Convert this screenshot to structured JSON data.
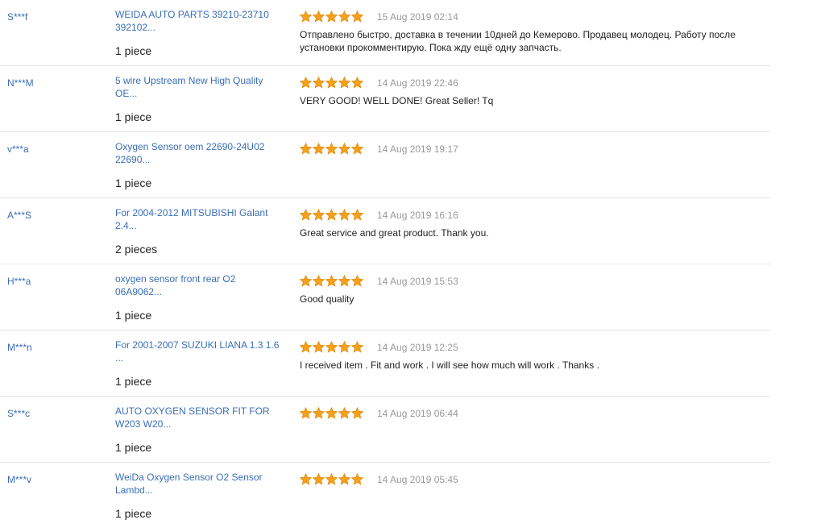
{
  "colors": {
    "link": "#3a6eb5",
    "star": "#f5a11e",
    "date": "#999999",
    "text": "#222222",
    "divider": "#e3e3e3"
  },
  "reviews": [
    {
      "user": "S***f",
      "product": "WEIDA AUTO PARTS 39210-23710 392102...",
      "quantity": "1 piece",
      "rating": 5,
      "date": "15 Aug 2019 02:14",
      "feedback": "Отправлено быстро, доставка в течении 10дней до Кемерово. Продавец молодец. Работу после установки прокомментирую. Пока жду ещё одну запчасть."
    },
    {
      "user": "N***M",
      "product": "5 wire Upstream New High Quality OE...",
      "quantity": "1 piece",
      "rating": 5,
      "date": "14 Aug 2019 22:46",
      "feedback": "VERY GOOD! WELL DONE! Great Seller! Tq"
    },
    {
      "user": "v***a",
      "product": "Oxygen Sensor oem 22690-24U02 22690...",
      "quantity": "1 piece",
      "rating": 5,
      "date": "14 Aug 2019 19:17",
      "feedback": ""
    },
    {
      "user": "A***S",
      "product": "For 2004-2012 MITSUBISHI Galant 2.4...",
      "quantity": "2 pieces",
      "rating": 5,
      "date": "14 Aug 2019 16:16",
      "feedback": "Great service and great product. Thank you."
    },
    {
      "user": "H***a",
      "product": "oxygen sensor front rear O2 06A9062...",
      "quantity": "1 piece",
      "rating": 5,
      "date": "14 Aug 2019 15:53",
      "feedback": "Good quality"
    },
    {
      "user": "M***n",
      "product": "For 2001-2007 SUZUKI LIANA 1.3 1.6 ...",
      "quantity": "1 piece",
      "rating": 5,
      "date": "14 Aug 2019 12:25",
      "feedback": "I received item . Fit and work . I will see how much will work . Thanks ."
    },
    {
      "user": "S***c",
      "product": "AUTO OXYGEN SENSOR FIT FOR W203 W20...",
      "quantity": "1 piece",
      "rating": 5,
      "date": "14 Aug 2019 06:44",
      "feedback": ""
    },
    {
      "user": "M***v",
      "product": "WeiDa Oxygen Sensor O2 Sensor Lambd...",
      "quantity": "1 piece",
      "rating": 5,
      "date": "14 Aug 2019 05:45",
      "feedback": ""
    }
  ]
}
